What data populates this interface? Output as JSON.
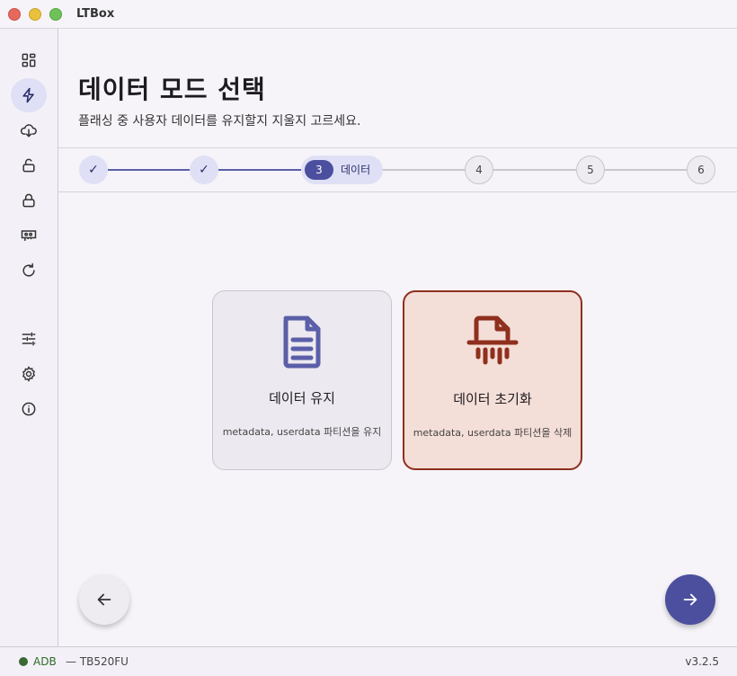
{
  "window": {
    "title": "LTBox"
  },
  "sidebar": {
    "items": [
      {
        "name": "dashboard-icon"
      },
      {
        "name": "flash-icon",
        "active": true
      },
      {
        "name": "cloud-download-icon"
      },
      {
        "name": "unlock-icon"
      },
      {
        "name": "lock-icon"
      },
      {
        "name": "memory-chip-icon"
      },
      {
        "name": "refresh-icon"
      },
      {
        "name": "tune-icon"
      },
      {
        "name": "gear-icon"
      },
      {
        "name": "info-icon"
      }
    ]
  },
  "header": {
    "title": "데이터 모드 선택",
    "subtitle": "플래싱 중 사용자 데이터를 유지할지 지울지 고르세요."
  },
  "stepper": {
    "steps": [
      {
        "label": "✓",
        "state": "done"
      },
      {
        "label": "✓",
        "state": "done"
      },
      {
        "label": "3",
        "state": "active",
        "name": "데이터"
      },
      {
        "label": "4",
        "state": "todo"
      },
      {
        "label": "5",
        "state": "todo"
      },
      {
        "label": "6",
        "state": "todo"
      }
    ]
  },
  "options": {
    "keep": {
      "title": "데이터 유지",
      "desc": "metadata, userdata 파티션을 유지",
      "icon": "document-icon"
    },
    "reset": {
      "title": "데이터 초기화",
      "desc": "metadata, userdata 파티션을 삭제",
      "icon": "shredder-icon",
      "selected": true
    }
  },
  "colors": {
    "accent": "#4b4f9e",
    "danger": "#8f2f1d",
    "dangerBg": "#f4ded8",
    "ok": "#3a6a33"
  },
  "status": {
    "adb": "ADB",
    "device": "— TB520FU",
    "version": "v3.2.5"
  }
}
